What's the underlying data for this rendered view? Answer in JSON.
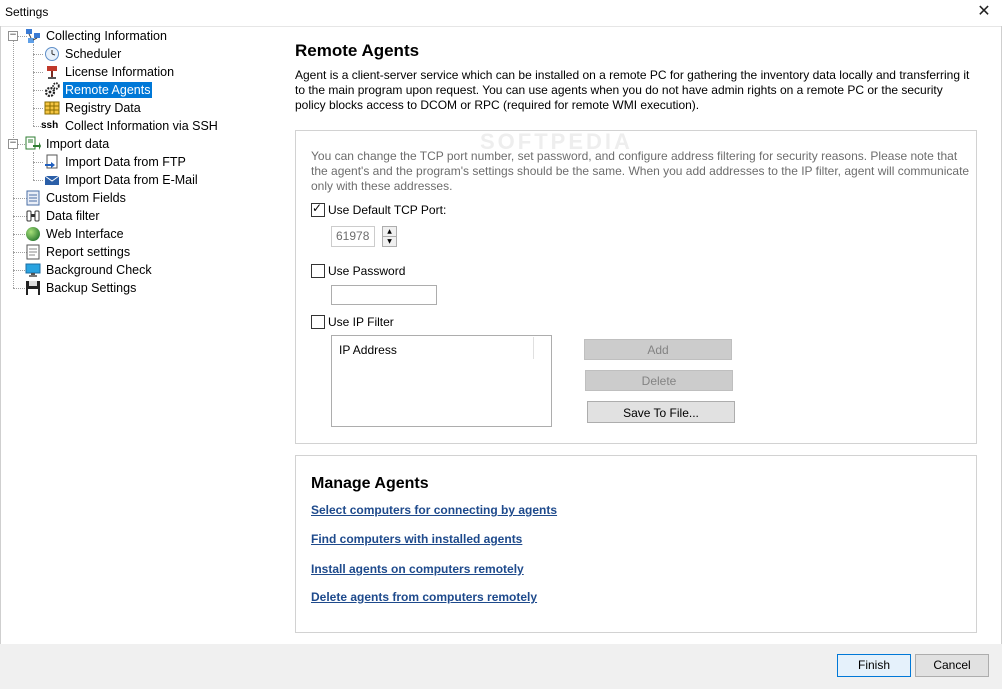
{
  "window": {
    "title": "Settings"
  },
  "tree": {
    "items": [
      {
        "label": "Collecting Information",
        "icon": "collecting-network-icon"
      },
      {
        "label": "Scheduler",
        "icon": "clock-icon"
      },
      {
        "label": "License Information",
        "icon": "stamp-icon"
      },
      {
        "label": "Remote Agents",
        "icon": "gears-icon"
      },
      {
        "label": "Registry Data",
        "icon": "grid-icon"
      },
      {
        "label": "Collect Information via SSH",
        "icon_text": "ssh"
      },
      {
        "label": "Import data",
        "icon": "import-icon"
      },
      {
        "label": "Import Data from FTP",
        "icon": "ftp-icon"
      },
      {
        "label": "Import Data from E-Mail",
        "icon": "email-icon"
      },
      {
        "label": "Custom Fields",
        "icon": "list-icon"
      },
      {
        "label": "Data filter",
        "icon": "binoculars-icon"
      },
      {
        "label": "Web Interface",
        "icon": "globe-icon"
      },
      {
        "label": "Report settings",
        "icon": "report-icon"
      },
      {
        "label": "Background Check",
        "icon": "monitor-icon"
      },
      {
        "label": "Backup Settings",
        "icon": "floppy-icon"
      }
    ],
    "selected": "Remote Agents"
  },
  "content": {
    "heading": "Remote Agents",
    "description": "Agent is a client-server service which can be installed on a remote PC for gathering the inventory data locally and transferring it to the main program upon request. You can use agents when you do not have admin rights on a remote PC or the security policy blocks access to DCOM or RPC (required for remote WMI execution).",
    "note": "You can change the TCP port number, set password, and configure address filtering for security reasons. Please note that the agent's and the program's settings should be the same. When you add addresses to the IP filter, agent will communicate only with these addresses.",
    "use_default_port": {
      "label": "Use Default TCP Port:",
      "checked": true
    },
    "port_value": "61978",
    "use_password": {
      "label": "Use Password",
      "checked": false
    },
    "password_value": "",
    "use_ip_filter": {
      "label": "Use IP Filter",
      "checked": false
    },
    "ip_list_header": "IP Address",
    "add_label": "Add",
    "delete_label": "Delete",
    "save_label": "Save To File...",
    "watermark": "SOFTPEDIA"
  },
  "manage": {
    "heading": "Manage Agents",
    "links": [
      "Select computers for connecting by agents",
      "Find computers with installed agents",
      "Install agents on computers remotely",
      "Delete agents from computers remotely"
    ]
  },
  "footer": {
    "finish_label": "Finish",
    "cancel_label": "Cancel"
  },
  "colors": {
    "selection": "#0078d7",
    "link": "#1e4a8c",
    "disabled_button": "#cccccc"
  }
}
